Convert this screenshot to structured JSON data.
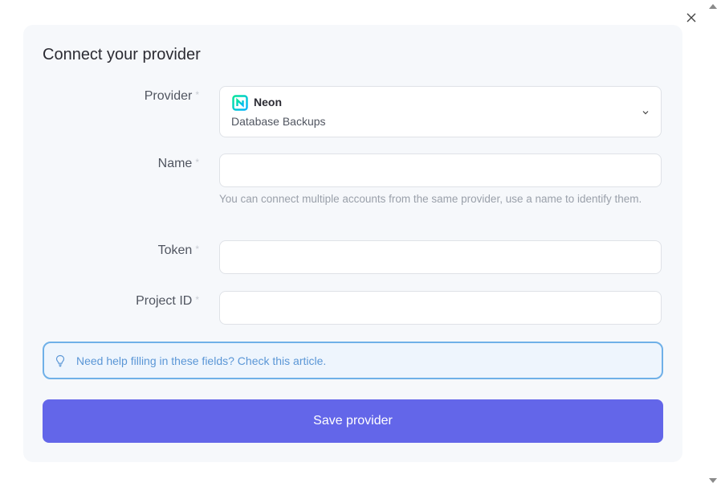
{
  "dialog": {
    "title": "Connect your provider",
    "close_icon": "close-icon"
  },
  "form": {
    "provider": {
      "label": "Provider",
      "required_mark": "*",
      "selected_name": "Neon",
      "selected_subtitle": "Database Backups",
      "icon": "neon-logo-icon"
    },
    "name": {
      "label": "Name",
      "required_mark": "*",
      "value": "",
      "help": "You can connect multiple accounts from the same provider, use a name to identify them."
    },
    "token": {
      "label": "Token",
      "required_mark": "*",
      "value": ""
    },
    "project_id": {
      "label": "Project ID",
      "required_mark": "*",
      "value": ""
    }
  },
  "help_banner": {
    "text": "Need help filling in these fields? Check this article.",
    "icon": "lightbulb-icon"
  },
  "save_button": {
    "label": "Save provider"
  },
  "colors": {
    "accent": "#6366e9",
    "info": "#5a96d6",
    "neon_green": "#00e599"
  }
}
